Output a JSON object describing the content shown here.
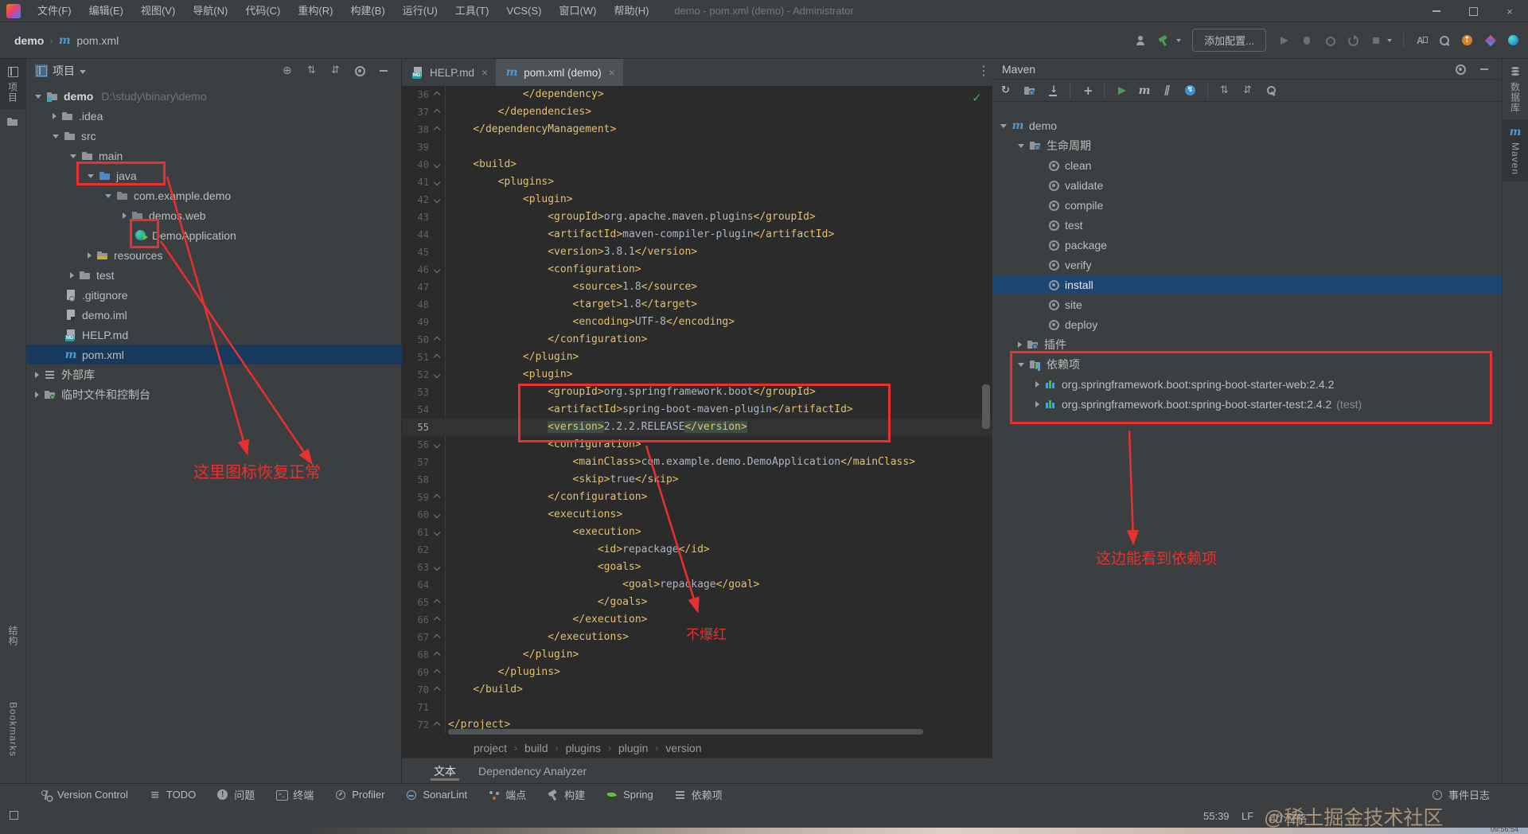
{
  "colors": {
    "annotation_red": "#e8312e",
    "selection_blue": "#173a5c",
    "install_selection": "#1e4570",
    "chrome": "#3c3f41",
    "editor_bg": "#2b2b2b",
    "tag_gold": "#e8bf6a",
    "code_text": "#a9b7c6"
  },
  "window": {
    "title": "demo - pom.xml (demo) - Administrator"
  },
  "menu_bar": {
    "items": [
      "文件(F)",
      "编辑(E)",
      "视图(V)",
      "导航(N)",
      "代码(C)",
      "重构(R)",
      "构建(B)",
      "运行(U)",
      "工具(T)",
      "VCS(S)",
      "窗口(W)",
      "帮助(H)"
    ]
  },
  "toolbar": {
    "breadcrumb": [
      "demo",
      "pom.xml"
    ],
    "add_config_label": "添加配置...",
    "left_icons": [
      "user",
      "build-hammer"
    ],
    "run_icons": [
      "run",
      "debug-bug",
      "profile",
      "rerun",
      "stop"
    ],
    "far_icons": [
      "translate",
      "search",
      "update",
      "ide-gem",
      "plugin-gem"
    ]
  },
  "left_stripe": {
    "top": [
      {
        "icon": "grid",
        "label": "项目"
      },
      {
        "icon": "folder",
        "label": ""
      }
    ],
    "bottom": [
      "结构",
      "Bookmarks"
    ]
  },
  "project_panel": {
    "title": "项目",
    "header_icons": [
      "locate",
      "collapse-all",
      "expand-all",
      "settings-gear",
      "hide"
    ],
    "tree": [
      {
        "label": "demo",
        "hint": "D:\\study\\binary\\demo",
        "icon": "project-folder",
        "level": 0,
        "chev": "e",
        "bold": true
      },
      {
        "label": ".idea",
        "icon": "folder",
        "level": 1,
        "chev": "c"
      },
      {
        "label": "src",
        "icon": "folder",
        "level": 1,
        "chev": "e"
      },
      {
        "label": "main",
        "icon": "folder",
        "level": 2,
        "chev": "e"
      },
      {
        "label": "java",
        "icon": "sources-folder",
        "level": 3,
        "chev": "e"
      },
      {
        "label": "com.example.demo",
        "icon": "package",
        "level": 4,
        "chev": "e"
      },
      {
        "label": "demos.web",
        "icon": "package",
        "level": 5,
        "chev": "c"
      },
      {
        "label": "DemoApplication",
        "icon": "spring-boot-class",
        "level": 5
      },
      {
        "label": "resources",
        "icon": "resources-folder",
        "level": 3,
        "chev": "c"
      },
      {
        "label": "test",
        "icon": "folder",
        "level": 2,
        "chev": "c"
      },
      {
        "label": ".gitignore",
        "icon": "gitignore-file",
        "level": 1
      },
      {
        "label": "demo.iml",
        "icon": "iml-file",
        "level": 1
      },
      {
        "label": "HELP.md",
        "icon": "md-file",
        "level": 1
      },
      {
        "label": "pom.xml",
        "icon": "maven",
        "level": 1,
        "selected": true
      },
      {
        "label": "外部库",
        "icon": "libraries",
        "level": 0,
        "chev": "c"
      },
      {
        "label": "临时文件和控制台",
        "icon": "scratches-folder",
        "level": 0,
        "chev": "c"
      }
    ]
  },
  "editor": {
    "tabs": [
      {
        "icon": "md-file",
        "label": "HELP.md"
      },
      {
        "icon": "maven",
        "label": "pom.xml (demo)",
        "active": true
      }
    ],
    "lines": [
      {
        "n": 36,
        "f": "c",
        "c": "            </dependency>"
      },
      {
        "n": 37,
        "f": "c",
        "c": "        </dependencies>"
      },
      {
        "n": 38,
        "f": "c",
        "c": "    </dependencyManagement>"
      },
      {
        "n": 39,
        "c": ""
      },
      {
        "n": 40,
        "f": "o",
        "c": "    <build>"
      },
      {
        "n": 41,
        "f": "o",
        "c": "        <plugins>"
      },
      {
        "n": 42,
        "f": "o",
        "c": "            <plugin>"
      },
      {
        "n": 43,
        "c": "                <groupId>org.apache.maven.plugins</groupId>"
      },
      {
        "n": 44,
        "c": "                <artifactId>maven-compiler-plugin</artifactId>"
      },
      {
        "n": 45,
        "c": "                <version>3.8.1</version>"
      },
      {
        "n": 46,
        "f": "o",
        "c": "                <configuration>"
      },
      {
        "n": 47,
        "c": "                    <source>1.8</source>"
      },
      {
        "n": 48,
        "c": "                    <target>1.8</target>"
      },
      {
        "n": 49,
        "c": "                    <encoding>UTF-8</encoding>"
      },
      {
        "n": 50,
        "f": "c",
        "c": "                </configuration>"
      },
      {
        "n": 51,
        "f": "c",
        "c": "            </plugin>"
      },
      {
        "n": 52,
        "f": "o",
        "c": "            <plugin>"
      },
      {
        "n": 53,
        "c": "                <groupId>org.springframework.boot</groupId>"
      },
      {
        "n": 54,
        "c": "                <artifactId>spring-boot-maven-plugin</artifactId>"
      },
      {
        "n": 55,
        "hl": true,
        "caret": true,
        "c": "                <version>2.2.2.RELEASE</version>"
      },
      {
        "n": 56,
        "f": "o",
        "c": "                <configuration>"
      },
      {
        "n": 57,
        "c": "                    <mainClass>com.example.demo.DemoApplication</mainClass>"
      },
      {
        "n": 58,
        "c": "                    <skip>true</skip>"
      },
      {
        "n": 59,
        "f": "c",
        "c": "                </configuration>"
      },
      {
        "n": 60,
        "f": "o",
        "c": "                <executions>"
      },
      {
        "n": 61,
        "f": "o",
        "c": "                    <execution>"
      },
      {
        "n": 62,
        "c": "                        <id>repackage</id>"
      },
      {
        "n": 63,
        "f": "o",
        "c": "                        <goals>"
      },
      {
        "n": 64,
        "c": "                            <goal>repackage</goal>"
      },
      {
        "n": 65,
        "f": "c",
        "c": "                        </goals>"
      },
      {
        "n": 66,
        "f": "c",
        "c": "                    </execution>"
      },
      {
        "n": 67,
        "f": "c",
        "c": "                </executions>"
      },
      {
        "n": 68,
        "f": "c",
        "c": "            </plugin>"
      },
      {
        "n": 69,
        "f": "c",
        "c": "        </plugins>"
      },
      {
        "n": 70,
        "f": "c",
        "c": "    </build>"
      },
      {
        "n": 71,
        "c": ""
      },
      {
        "n": 72,
        "f": "c",
        "c": "</project>"
      }
    ],
    "breadcrumb": [
      "project",
      "build",
      "plugins",
      "plugin",
      "version"
    ],
    "tool_tabs": [
      {
        "label": "文本",
        "active": true
      },
      {
        "label": "Dependency Analyzer"
      }
    ]
  },
  "maven_panel": {
    "title": "Maven",
    "header_icons": [
      "settings-gear",
      "hide"
    ],
    "toolbar_icons": [
      "refresh",
      "sources",
      "download",
      "|",
      "plus",
      "|",
      "run-green",
      "m-goal",
      "skip-tests",
      "offline",
      "|",
      "collapse-all",
      "expand-all",
      "wrench"
    ],
    "tree": [
      {
        "label": "demo",
        "icon": "maven-project",
        "level": 0,
        "chev": "e"
      },
      {
        "label": "生命周期",
        "icon": "folder-gear",
        "level": 1,
        "chev": "e"
      },
      {
        "label": "clean",
        "icon": "goal",
        "level": 2
      },
      {
        "label": "validate",
        "icon": "goal",
        "level": 2
      },
      {
        "label": "compile",
        "icon": "goal",
        "level": 2
      },
      {
        "label": "test",
        "icon": "goal",
        "level": 2
      },
      {
        "label": "package",
        "icon": "goal",
        "level": 2
      },
      {
        "label": "verify",
        "icon": "goal",
        "level": 2
      },
      {
        "label": "install",
        "icon": "goal",
        "level": 2,
        "selected": true
      },
      {
        "label": "site",
        "icon": "goal",
        "level": 2
      },
      {
        "label": "deploy",
        "icon": "goal",
        "level": 2
      },
      {
        "label": "插件",
        "icon": "folder-gear",
        "level": 1,
        "chev": "c"
      },
      {
        "label": "依赖项",
        "icon": "deps-folder",
        "level": 1,
        "chev": "e"
      },
      {
        "label": "org.springframework.boot:spring-boot-starter-web:2.4.2",
        "icon": "dependency",
        "level": 2,
        "chev": "c"
      },
      {
        "label": "org.springframework.boot:spring-boot-starter-test:2.4.2",
        "suffix": " (test)",
        "icon": "dependency",
        "level": 2,
        "chev": "c"
      }
    ]
  },
  "right_stripe": {
    "items": [
      {
        "icon": "database",
        "label": "数据库"
      },
      {
        "icon": "maven",
        "label": "Maven",
        "active": true
      }
    ]
  },
  "status_bar": {
    "buttons": [
      {
        "icon": "git-branch",
        "label": "Version Control"
      },
      {
        "icon": "todo",
        "label": "TODO"
      },
      {
        "icon": "problem",
        "label": "问题"
      },
      {
        "icon": "terminal",
        "label": "终端"
      },
      {
        "icon": "profiler",
        "label": "Profiler"
      },
      {
        "icon": "sonarlint",
        "label": "SonarLint"
      },
      {
        "icon": "endpoints",
        "label": "端点"
      },
      {
        "icon": "hammer",
        "label": "构建"
      },
      {
        "icon": "spring",
        "label": "Spring"
      },
      {
        "icon": "layers",
        "label": "依赖项"
      }
    ],
    "event_log": "事件日志",
    "caret_position": "55:39",
    "line_separator": "LF",
    "indent_info": "4个空格"
  },
  "annotations": {
    "icons_fixed": "这里图标恢复正常",
    "no_red": "不爆红",
    "deps_visible": "这边能看到依赖项"
  },
  "watermark": {
    "text": "@稀土掘金技术社区",
    "time": "09:56:54"
  }
}
